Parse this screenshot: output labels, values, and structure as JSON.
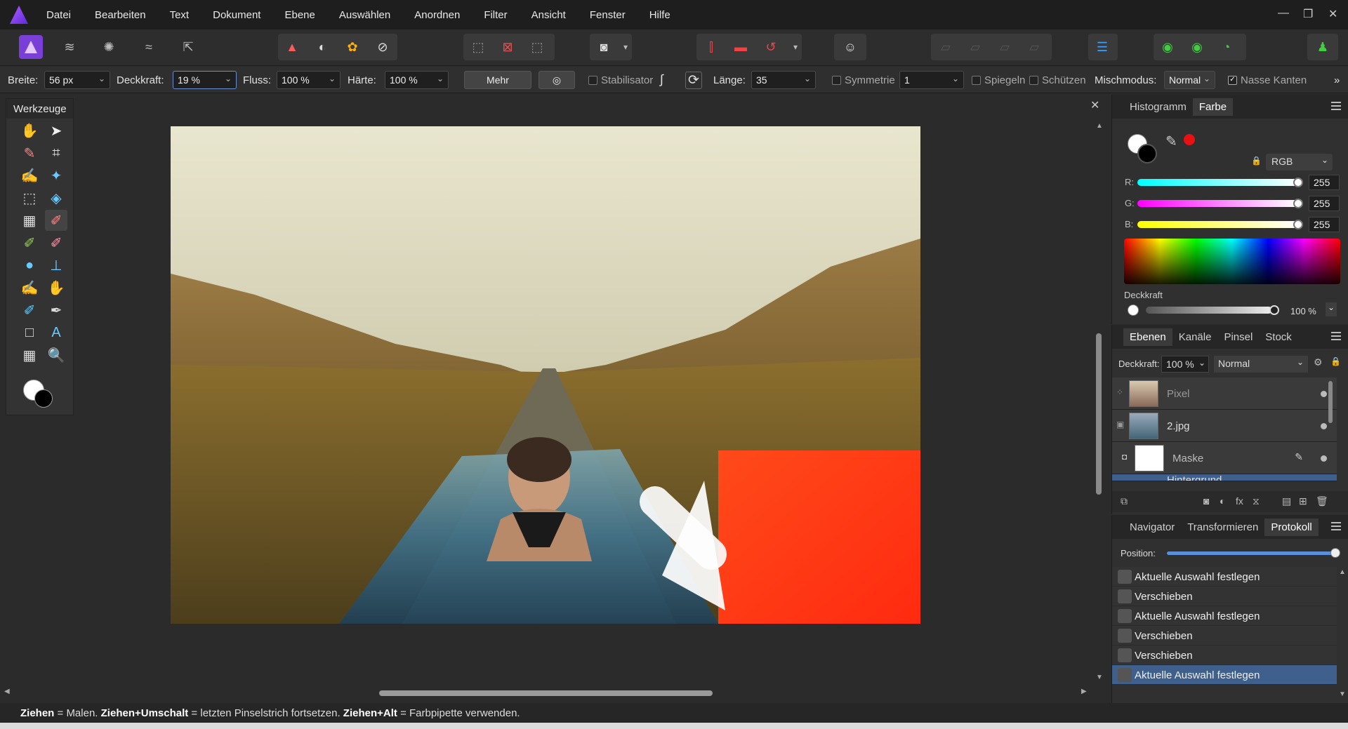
{
  "app": {
    "menu": [
      "Datei",
      "Bearbeiten",
      "Text",
      "Dokument",
      "Ebene",
      "Auswählen",
      "Anordnen",
      "Filter",
      "Ansicht",
      "Fenster",
      "Hilfe"
    ]
  },
  "context": {
    "breite_label": "Breite:",
    "breite_value": "56 px",
    "deckkraft_label": "Deckkraft:",
    "deckkraft_value": "19 %",
    "fluss_label": "Fluss:",
    "fluss_value": "100 %",
    "haerte_label": "Härte:",
    "haerte_value": "100 %",
    "mehr": "Mehr",
    "stabilisator": "Stabilisator",
    "laenge_label": "Länge:",
    "laenge_value": "35",
    "symmetrie": "Symmetrie",
    "symmetrie_value": "1",
    "spiegeln": "Spiegeln",
    "schuetzen": "Schützen",
    "mischmodus_label": "Mischmodus:",
    "mischmodus_value": "Normal",
    "nasse_kanten": "Nasse Kanten"
  },
  "tools": {
    "title": "Werkzeuge"
  },
  "color_panel": {
    "tabs": [
      "Histogramm",
      "Farbe"
    ],
    "mode": "RGB",
    "r_label": "R:",
    "r_value": "255",
    "g_label": "G:",
    "g_value": "255",
    "b_label": "B:",
    "b_value": "255",
    "deckkraft_label": "Deckkraft",
    "deckkraft_value": "100 %"
  },
  "layers_panel": {
    "tabs": [
      "Ebenen",
      "Kanäle",
      "Pinsel",
      "Stock"
    ],
    "deckkraft_label": "Deckkraft:",
    "deckkraft_value": "100 %",
    "blend": "Normal",
    "layers": [
      {
        "name": "Pixel"
      },
      {
        "name": "2.jpg"
      },
      {
        "name": "Maske"
      },
      {
        "name": "Hintergrund"
      }
    ]
  },
  "history_panel": {
    "tabs": [
      "Navigator",
      "Transformieren",
      "Protokoll"
    ],
    "position_label": "Position:",
    "items": [
      "Aktuelle Auswahl festlegen",
      "Verschieben",
      "Aktuelle Auswahl festlegen",
      "Verschieben",
      "Verschieben",
      "Aktuelle Auswahl festlegen"
    ],
    "selected_index": 5
  },
  "status": {
    "k1": "Ziehen",
    "t1": " = Malen. ",
    "k2": "Ziehen+Umschalt",
    "t2": " = letzten Pinselstrich fortsetzen. ",
    "k3": "Ziehen+Alt",
    "t3": " = Farbpipette verwenden."
  },
  "colors": {
    "accent": "#3f5f8c",
    "red": "#ff3a1a"
  }
}
